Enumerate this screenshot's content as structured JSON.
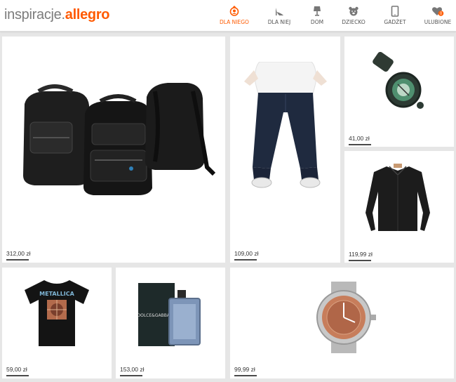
{
  "logo": {
    "part1": "inspiracje.",
    "part2": "allegro"
  },
  "nav": [
    {
      "label": "DLA NIEGO",
      "icon": "man-icon",
      "active": true
    },
    {
      "label": "DLA NIEJ",
      "icon": "high-heel-icon",
      "active": false
    },
    {
      "label": "DOM",
      "icon": "lamp-icon",
      "active": false
    },
    {
      "label": "DZIECKO",
      "icon": "teddy-bear-icon",
      "active": false
    },
    {
      "label": "GADŻET",
      "icon": "tablet-icon",
      "active": false
    },
    {
      "label": "ULUBIONE",
      "icon": "heart-icon",
      "active": false,
      "badge": "0"
    }
  ],
  "products": [
    {
      "name": "backpacks",
      "price": "312,00 zł"
    },
    {
      "name": "jeans",
      "price": "109,00 zł"
    },
    {
      "name": "compass",
      "price": "41,00 zł"
    },
    {
      "name": "shirt",
      "price": "119,99 zł"
    },
    {
      "name": "tshirt",
      "price": "59,00 zł"
    },
    {
      "name": "perfume",
      "price": "153,00 zł"
    },
    {
      "name": "watch",
      "price": "99,99 zł"
    }
  ],
  "colors": {
    "accent": "#ff5a00",
    "background": "#e6e6e6"
  }
}
